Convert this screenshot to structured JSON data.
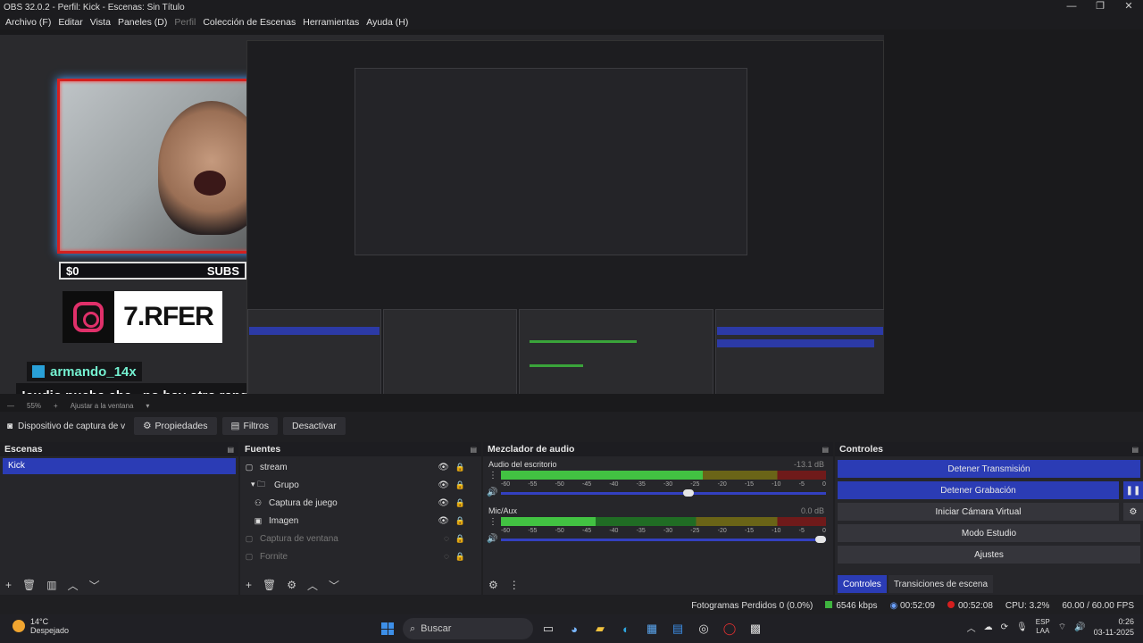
{
  "window": {
    "title": "OBS 32.0.2 - Perfil: Kick - Escenas: Sin Título",
    "minimize": "—",
    "maximize": "❐",
    "close": "✕"
  },
  "menu": [
    "Archivo (F)",
    "Editar",
    "Vista",
    "Paneles (D)",
    "Perfil",
    "Colección de Escenas",
    "Herramientas",
    "Ayuda (H)"
  ],
  "overlay": {
    "money_left": "$0",
    "subs": "SUBS",
    "instagram": "7.RFER",
    "chat_user": "armando_14x",
    "chat_message": "!audio pucha che...no hay otro rango?"
  },
  "zoom": {
    "percent": "55%",
    "fit": "Ajustar a la ventana"
  },
  "source_bar": {
    "label": "Dispositivo de captura de v",
    "properties": "Propiedades",
    "filters": "Filtros",
    "deactivate": "Desactivar"
  },
  "scenes": {
    "title": "Escenas",
    "items": [
      "Kick"
    ]
  },
  "sources": {
    "title": "Fuentes",
    "items": [
      {
        "name": "stream",
        "icon": "▢",
        "dim": false
      },
      {
        "name": "Grupo",
        "icon": "▾ 🗀",
        "dim": false
      },
      {
        "name": "Captura de juego",
        "icon": "⚇",
        "dim": false
      },
      {
        "name": "Imagen",
        "icon": "▣",
        "dim": false
      },
      {
        "name": "Captura de ventana",
        "icon": "▢",
        "dim": true
      },
      {
        "name": "Fornite",
        "icon": "▢",
        "dim": true
      }
    ]
  },
  "mixer": {
    "title": "Mezclador de audio",
    "ticks": [
      "-60",
      "-55",
      "-50",
      "-45",
      "-40",
      "-35",
      "-30",
      "-25",
      "-20",
      "-15",
      "-10",
      "-5",
      "0"
    ],
    "channels": [
      {
        "name": "Audio del escritorio",
        "db": "-13.1 dB",
        "level": 0.62,
        "fader": 0.58
      },
      {
        "name": "Mic/Aux",
        "db": "0.0 dB",
        "level": 0.29,
        "fader": 1.0
      }
    ]
  },
  "controls": {
    "title": "Controles",
    "stop_stream": "Detener Transmisión",
    "stop_recording": "Detener Grabación",
    "virtual_cam": "Iniciar Cámara Virtual",
    "studio_mode": "Modo Estudio",
    "settings": "Ajustes",
    "tab_controls": "Controles",
    "tab_transitions": "Transiciones de escena"
  },
  "status": {
    "dropped": "Fotogramas Perdidos 0 (0.0%)",
    "bitrate": "6546 kbps",
    "stream_time": "00:52:09",
    "rec_time": "00:52:08",
    "cpu": "CPU: 3.2%",
    "fps": "60.00 / 60.00 FPS"
  },
  "taskbar": {
    "temp": "14°C",
    "weather": "Despejado",
    "search": "Buscar",
    "lang_top": "ESP",
    "lang_bottom": "LAA",
    "time": "0:26",
    "date": "03-11-2025"
  },
  "colors": {
    "accent": "#2b3cb5",
    "rec": "#d41f1f",
    "meter_green": "#42c242"
  }
}
